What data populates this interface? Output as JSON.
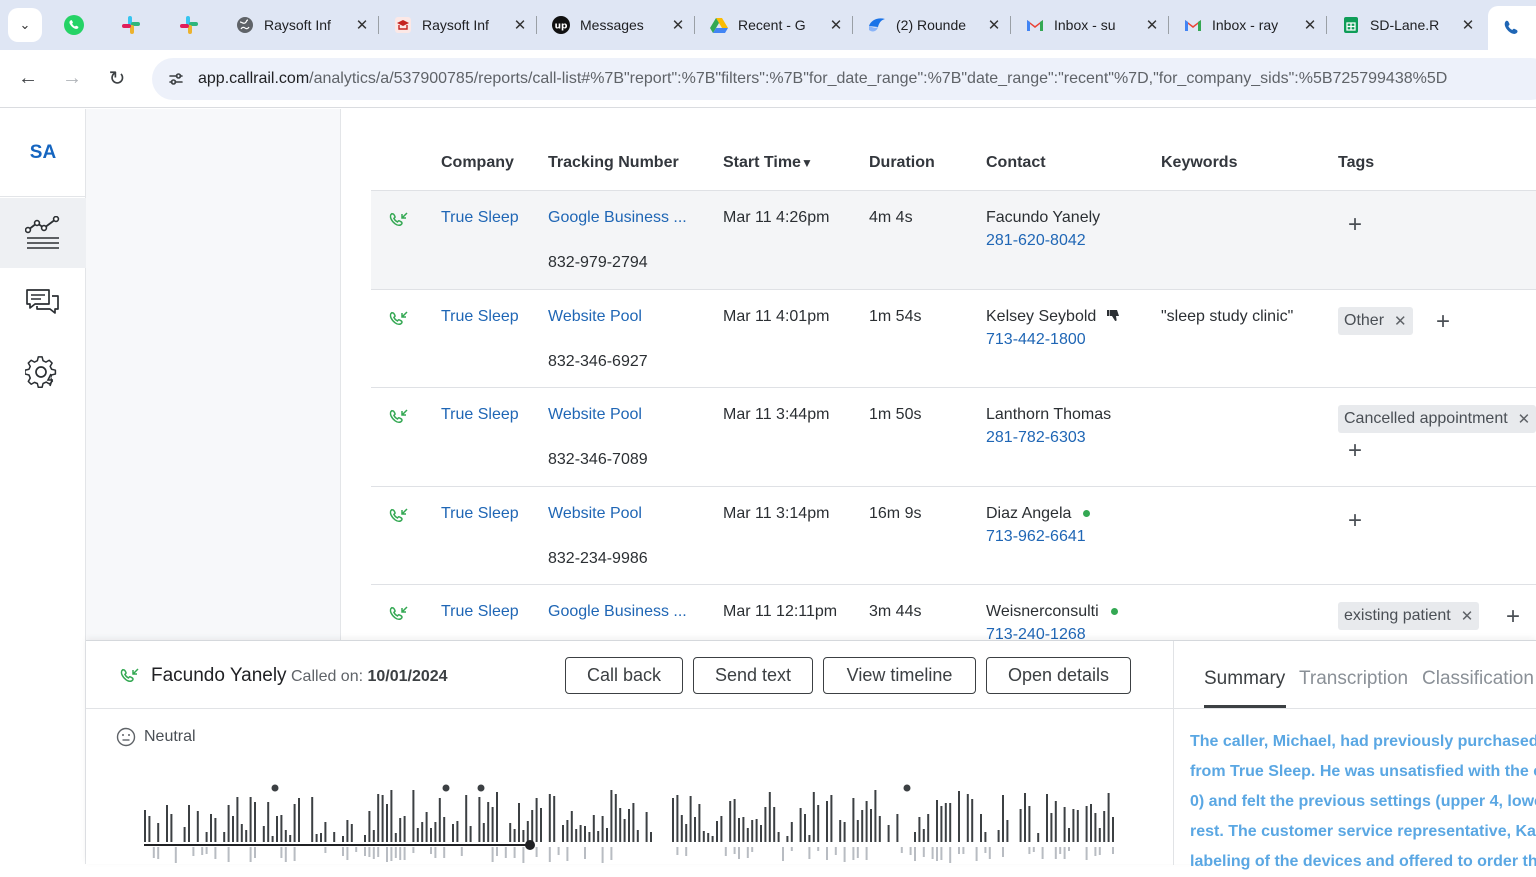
{
  "browser": {
    "tabs": [
      {
        "title": "Raysoft Inf",
        "favicon": "globe-icon"
      },
      {
        "title": "Raysoft Inf",
        "favicon": "hat-icon"
      },
      {
        "title": "Messages",
        "favicon": "upwork-icon"
      },
      {
        "title": "Recent - G",
        "favicon": "google-drive-icon"
      },
      {
        "title": "(2) Rounde",
        "favicon": "roundel-icon"
      },
      {
        "title": "Inbox - su",
        "favicon": "gmail-icon"
      },
      {
        "title": "Inbox - ray",
        "favicon": "gmail-icon"
      },
      {
        "title": "SD-Lane.R",
        "favicon": "google-sheets-icon"
      }
    ],
    "url_host": "app.callrail.com",
    "url_path": "/analytics/a/537900785/reports/call-list#%7B\"report\":%7B\"filters\":%7B\"for_date_range\":%7B\"date_range\":\"recent\"%7D,\"for_company_sids\":%5B725799438%5D"
  },
  "sidebar": {
    "org_initials": "SA",
    "items": [
      {
        "name": "analytics-icon"
      },
      {
        "name": "conversations-icon"
      },
      {
        "name": "settings-icon"
      }
    ]
  },
  "table": {
    "headers": {
      "company": "Company",
      "tracking_number": "Tracking Number",
      "start_time": "Start Time",
      "sort_indicator": "▼",
      "duration": "Duration",
      "contact": "Contact",
      "keywords": "Keywords",
      "tags": "Tags"
    },
    "rows": [
      {
        "company": "True Sleep",
        "tracking_source": "Google Business ...",
        "tracking_number": "832-979-2794",
        "start_time": "Mar 11 4:26pm",
        "duration": "4m 4s",
        "contact_name": "Facundo Yanely",
        "contact_phone": "281-620-8042",
        "keywords": "",
        "tags": []
      },
      {
        "company": "True Sleep",
        "tracking_source": "Website Pool",
        "tracking_number": "832-346-6927",
        "start_time": "Mar 11 4:01pm",
        "duration": "1m 54s",
        "contact_name": "Kelsey Seybold",
        "contact_phone": "713-442-1800",
        "keywords": "\"sleep study clinic\"",
        "tags": [
          "Other"
        ]
      },
      {
        "company": "True Sleep",
        "tracking_source": "Website Pool",
        "tracking_number": "832-346-7089",
        "start_time": "Mar 11 3:44pm",
        "duration": "1m 50s",
        "contact_name": "Lanthorn Thomas",
        "contact_phone": "281-782-6303",
        "keywords": "",
        "tags": [
          "Cancelled appointment"
        ]
      },
      {
        "company": "True Sleep",
        "tracking_source": "Website Pool",
        "tracking_number": "832-234-9986",
        "start_time": "Mar 11 3:14pm",
        "duration": "16m 9s",
        "contact_name": "Diaz Angela",
        "contact_phone": "713-962-6641",
        "keywords": "",
        "tags": []
      },
      {
        "company": "True Sleep",
        "tracking_source": "Google Business ...",
        "tracking_number": "",
        "start_time": "Mar 11 12:11pm",
        "duration": "3m 44s",
        "contact_name": "Weisnerconsulti",
        "contact_phone": "713-240-1268",
        "keywords": "",
        "tags": [
          "existing patient"
        ]
      }
    ]
  },
  "drawer": {
    "caller_name": "Facundo Yanely",
    "called_on_label": "Called on:",
    "called_on_date": "10/01/2024",
    "buttons": {
      "call_back": "Call back",
      "send_text": "Send text",
      "view_timeline": "View timeline",
      "open_details": "Open details"
    },
    "sentiment": "Neutral",
    "tabs": {
      "summary": "Summary",
      "transcription": "Transcription",
      "classification": "Classification"
    },
    "summary_lines": [
      "The caller, Michael, had previously purchased a",
      "from True Sleep. He was unsatisfied with the cu",
      "0) and felt the previous settings (upper 4, lowe",
      "rest. The customer service representative, Kate",
      "labeling of the devices and offered to order th"
    ]
  },
  "colors": {
    "link": "#1f66b5",
    "call_icon": "#34a853",
    "summary_text": "#5aa7e3",
    "tab_bar": "#dfe6f4"
  }
}
